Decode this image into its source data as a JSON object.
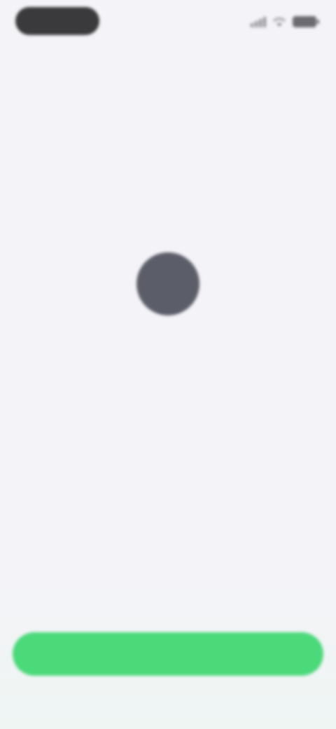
{
  "status_bar": {
    "time": ""
  },
  "intro": {
    "eyebrow": "",
    "headline": "",
    "subtext": ""
  },
  "cta": {
    "label": ""
  },
  "colors": {
    "background": "#f4f4f8",
    "avatar": "#5b5d68",
    "cta": "#4cd97a"
  },
  "icons": {
    "signal": "cellular-signal-icon",
    "wifi": "wifi-icon",
    "battery": "battery-icon"
  }
}
